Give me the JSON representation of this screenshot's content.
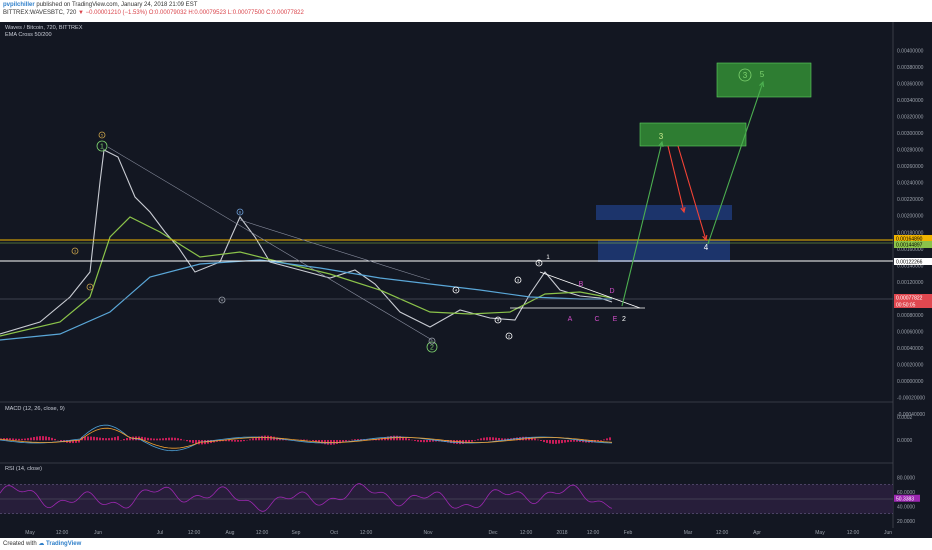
{
  "header": {
    "author": "pvpilchiller",
    "published": "published on TradingView.com, January 24, 2018 21:09 EST",
    "symbol_line": "BITTREX:WAVESBTC, 720",
    "change_arrow": "▼",
    "change": "−0.00001210 (−1.53%)",
    "ohlc": "O:0.00079032 H:0.00079523 L:0.00077500 C:0.00077822"
  },
  "legend": {
    "title": "Waves / Bitcoin, 720, BITTREX",
    "indicator": "EMA Cross 50/200",
    "macd": "MACD (12, 26, close, 9)",
    "rsi": "RSI (14, close)"
  },
  "footer": {
    "created": "Created with",
    "brand": "TradingView"
  },
  "colors": {
    "price": "#c9ccd3",
    "ema50": "#8bc34a",
    "ema200": "#5aa7d8",
    "macd": "#4fa3d9",
    "signal": "#f0a030",
    "hist": "#e91e63",
    "rsi": "#9c27b0",
    "up_arrow": "#4caf50",
    "down_arrow": "#f44336",
    "target_box": "#2e7d32",
    "zone_box": "#1e3a78",
    "orange_line": "#f0b400"
  },
  "chart_data": [
    {
      "type": "line",
      "panel": "price",
      "x_tick_labels": [
        "May",
        "12:00",
        "Jun",
        "Jul",
        "12:00",
        "Aug",
        "12:00",
        "Sep",
        "Oct",
        "12:00",
        "Nov",
        "Dec",
        "12:00",
        "2018",
        "12:00",
        "Feb",
        "Mar",
        "12:00",
        "Apr",
        "May",
        "12:00",
        "Jun"
      ],
      "y_tick_labels": [
        "0.00400000",
        "0.00380000",
        "0.00360000",
        "0.00340000",
        "0.00320000",
        "0.00300000",
        "0.00280000",
        "0.00260000",
        "0.00240000",
        "0.00220000",
        "0.00200000",
        "0.00180000",
        "0.00160000",
        "0.00140000",
        "0.00120000",
        "0.00100000",
        "0.00080000",
        "0.00060000",
        "0.00040000",
        "0.00020000",
        "0.00000000",
        "-0.00020000",
        "-0.00040000"
      ],
      "ylim": [
        -0.0004,
        0.0042
      ],
      "price_labels": [
        "0.00164890",
        "0.00144897",
        "0.00122266",
        "0.00077822",
        "00:50:05"
      ],
      "series": [
        {
          "name": "Close",
          "x": [
            "May",
            "Jun",
            "Jul",
            "Aug",
            "Sep",
            "Oct",
            "Nov",
            "Dec",
            "2018",
            "Jan 24"
          ],
          "values": [
            0.0004,
            0.0025,
            0.0017,
            0.0015,
            0.0012,
            0.0011,
            0.0005,
            0.0006,
            0.0011,
            0.00078
          ]
        },
        {
          "name": "EMA 50",
          "x": [
            "May",
            "Jun",
            "Jul",
            "Aug",
            "Sep",
            "Oct",
            "Nov",
            "Dec",
            "2018",
            "Jan 24"
          ],
          "values": [
            0.0004,
            0.0012,
            0.0019,
            0.0014,
            0.0013,
            0.0011,
            0.0007,
            0.0007,
            0.0009,
            0.00087
          ]
        },
        {
          "name": "EMA 200",
          "x": [
            "May",
            "Jun",
            "Jul",
            "Aug",
            "Sep",
            "Oct",
            "Nov",
            "Dec",
            "2018",
            "Jan 24"
          ],
          "values": [
            0.0002,
            0.0006,
            0.0011,
            0.0013,
            0.0013,
            0.0012,
            0.001,
            0.0009,
            0.00085,
            0.00085
          ]
        }
      ],
      "horizontal_levels": [
        0.0016489,
        0.00122266,
        0.00077822
      ],
      "wave_labels": [
        {
          "text": "1",
          "circled": true,
          "color": "green",
          "price": 0.00292
        },
        {
          "text": "2",
          "circled": true,
          "color": "green",
          "price": 0.00025
        },
        {
          "text": "3",
          "circled": false,
          "color": "green",
          "price": 0.00262
        },
        {
          "text": "4",
          "circled": false,
          "color": "white",
          "price": 0.00146
        },
        {
          "text": "3",
          "circled": true,
          "color": "green",
          "price": 0.00348
        },
        {
          "text": "5",
          "circled": false,
          "color": "green",
          "price": 0.00348
        }
      ],
      "abcde": [
        "A",
        "B",
        "C",
        "D",
        "E"
      ],
      "target_label": "2"
    },
    {
      "type": "line",
      "panel": "macd",
      "y_tick_labels": [
        "0.0002",
        "0.0000"
      ],
      "series": [
        {
          "name": "MACD"
        },
        {
          "name": "Signal"
        },
        {
          "name": "Histogram"
        }
      ]
    },
    {
      "type": "line",
      "panel": "rsi",
      "y_tick_labels": [
        "80.0000",
        "60.0000",
        "50.3383",
        "40.0000",
        "20.0000"
      ],
      "ylim": [
        10,
        90
      ],
      "last_value": 50.3383
    }
  ]
}
